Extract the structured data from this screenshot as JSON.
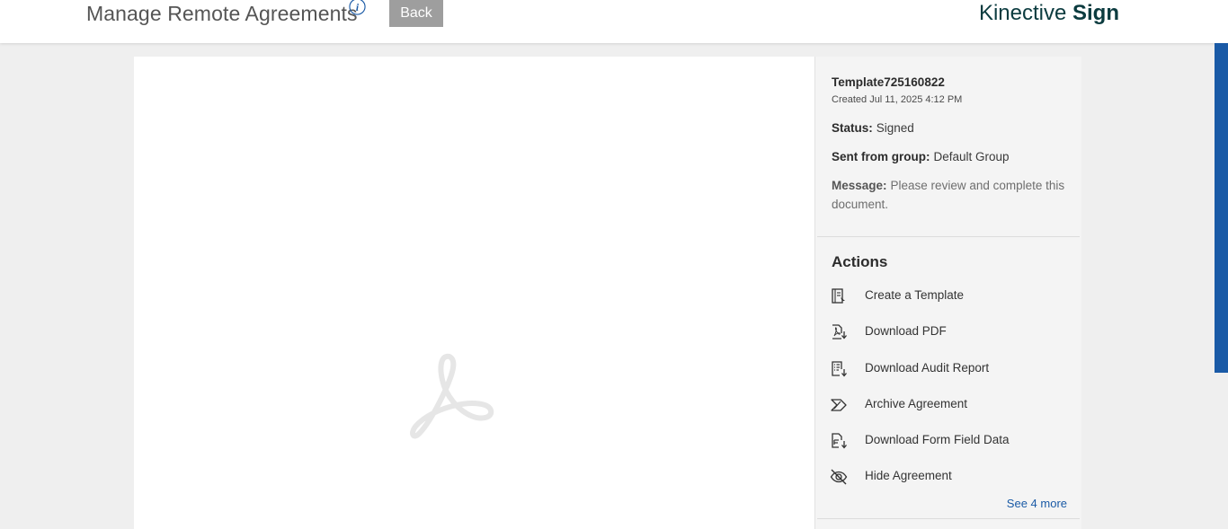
{
  "header": {
    "title": "Manage Remote Agreements",
    "info_icon": "info-icon",
    "back_label": "Back",
    "brand_light": "Kinective",
    "brand_bold": "Sign",
    "brand_color": "#0b3b3f"
  },
  "viewer": {
    "placeholder_icon": "acrobat-icon"
  },
  "agreement": {
    "name": "Template725160822",
    "created": "Created Jul 11, 2025 4:12 PM",
    "status_label": "Status:",
    "status_value": "Signed",
    "group_label": "Sent from group:",
    "group_value": "Default Group",
    "message_label": "Message:",
    "message_value": "Please review and complete this document."
  },
  "actions": {
    "title": "Actions",
    "items": [
      {
        "label": "Create a Template",
        "icon": "template-icon"
      },
      {
        "label": "Download PDF",
        "icon": "download-pdf-icon"
      },
      {
        "label": "Download Audit Report",
        "icon": "audit-report-icon"
      },
      {
        "label": "Archive Agreement",
        "icon": "archive-icon"
      },
      {
        "label": "Download Form Field Data",
        "icon": "form-data-icon"
      },
      {
        "label": "Hide Agreement",
        "icon": "hide-eye-icon"
      }
    ],
    "see_more": "See 4 more",
    "link_color": "#1a5aa6"
  }
}
